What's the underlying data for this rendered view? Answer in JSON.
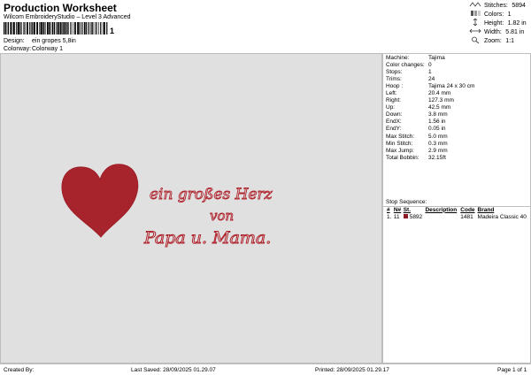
{
  "header": {
    "title": "Production Worksheet",
    "subtitle": "Wilcom EmbroideryStudio – Level 3 Advanced",
    "barcode_number": "1",
    "design_label": "Design:",
    "design_value": "ein gropes 5,8in",
    "colorway_label": "Colorway:",
    "colorway_value": "Colorway 1"
  },
  "stats": [
    {
      "label": "Stitches:",
      "value": "5894"
    },
    {
      "label": "Colors:",
      "value": "1"
    },
    {
      "label": "Height:",
      "value": "1.82 in"
    },
    {
      "label": "Width:",
      "value": "5.81 in"
    },
    {
      "label": "Zoom:",
      "value": "1:1"
    }
  ],
  "info": [
    {
      "label": "Machine:",
      "value": "Tajima"
    },
    {
      "label": "Color changes:",
      "value": "0"
    },
    {
      "label": "Stops:",
      "value": "1"
    },
    {
      "label": "Trims:",
      "value": "24"
    },
    {
      "label": "Hoop :",
      "value": "Tajima 24 x 30 cm"
    },
    {
      "label": "Left:",
      "value": "20.4 mm"
    },
    {
      "label": "Right:",
      "value": "127.3 mm"
    },
    {
      "label": "Up:",
      "value": "42.5 mm"
    },
    {
      "label": "Down:",
      "value": "3.8 mm"
    },
    {
      "label": "EndX:",
      "value": "1.56 in"
    },
    {
      "label": "EndY:",
      "value": "0.05 in"
    },
    {
      "label": "Max Stitch:",
      "value": "5.0 mm"
    },
    {
      "label": "Min Stitch:",
      "value": "0.3 mm"
    },
    {
      "label": "Max Jump:",
      "value": "2.9 mm"
    },
    {
      "label": "Total Bobbin:",
      "value": "32.15ft"
    }
  ],
  "stop_sequence": {
    "label": "Stop Sequence:",
    "headers": [
      "#",
      "N#",
      "St.",
      "Description",
      "Code",
      "Brand"
    ],
    "rows": [
      {
        "index": "1.",
        "needle": "11",
        "stitches": "5892",
        "description": "",
        "code": "1481",
        "brand": "Madeira Classic 40",
        "color": "#8e1b24"
      }
    ]
  },
  "design": {
    "thread_color": "#b0262f",
    "text_line1": "ein großes Herz",
    "text_line2": "von",
    "text_line3": "Papa u. Mama."
  },
  "footer": {
    "created_by": "Created By:",
    "last_saved": "Last Saved: 28/09/2025 01.29.07",
    "printed": "Printed: 28/09/2025 01.29.17",
    "page": "Page 1 of 1"
  }
}
